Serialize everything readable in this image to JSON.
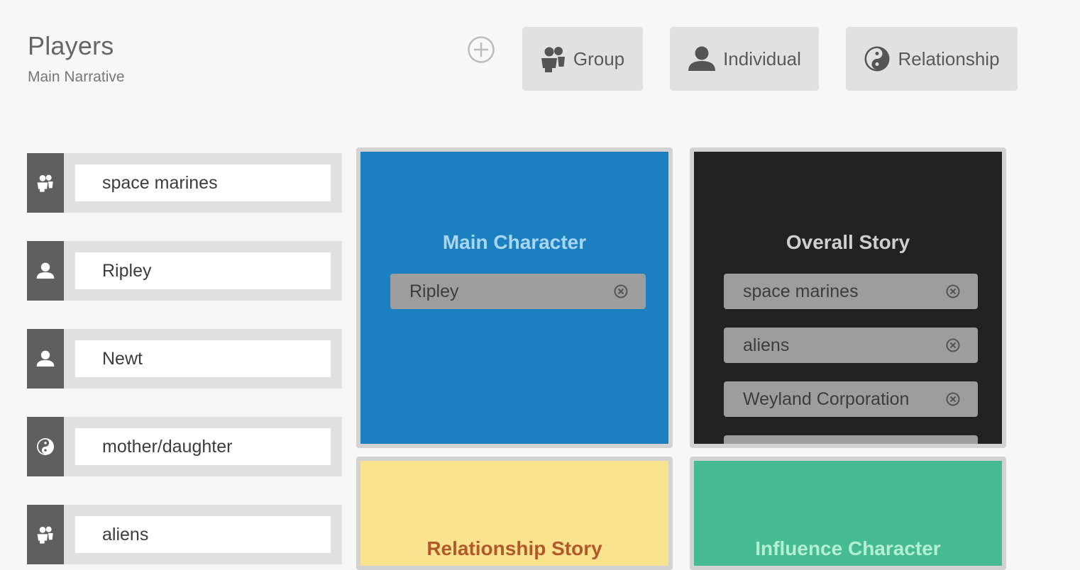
{
  "header": {
    "title": "Players",
    "subtitle": "Main Narrative"
  },
  "toolbar": {
    "add_icon": "plus-circle-icon",
    "buttons": [
      {
        "label": "Group",
        "icon": "group-icon"
      },
      {
        "label": "Individual",
        "icon": "person-icon"
      },
      {
        "label": "Relationship",
        "icon": "yin-yang-icon"
      }
    ]
  },
  "players": [
    {
      "name": "space marines",
      "type": "group"
    },
    {
      "name": "Ripley",
      "type": "individual"
    },
    {
      "name": "Newt",
      "type": "individual"
    },
    {
      "name": "mother/daughter",
      "type": "relationship"
    },
    {
      "name": "aliens",
      "type": "group"
    }
  ],
  "quads": {
    "main_character": {
      "title": "Main Character",
      "color": "#1b80bf",
      "title_color": "#a9d6f5",
      "chips": [
        "Ripley"
      ]
    },
    "overall_story": {
      "title": "Overall Story",
      "color": "#222222",
      "title_color": "#cfcfcf",
      "chips": [
        "space marines",
        "aliens",
        "Weyland Corporation"
      ]
    },
    "relationship_story": {
      "title": "Relationship Story",
      "color": "#f9e38e",
      "title_color": "#b2582a"
    },
    "influence_character": {
      "title": "Influence Character",
      "color": "#44bb92",
      "title_color": "#b4eed5"
    }
  }
}
